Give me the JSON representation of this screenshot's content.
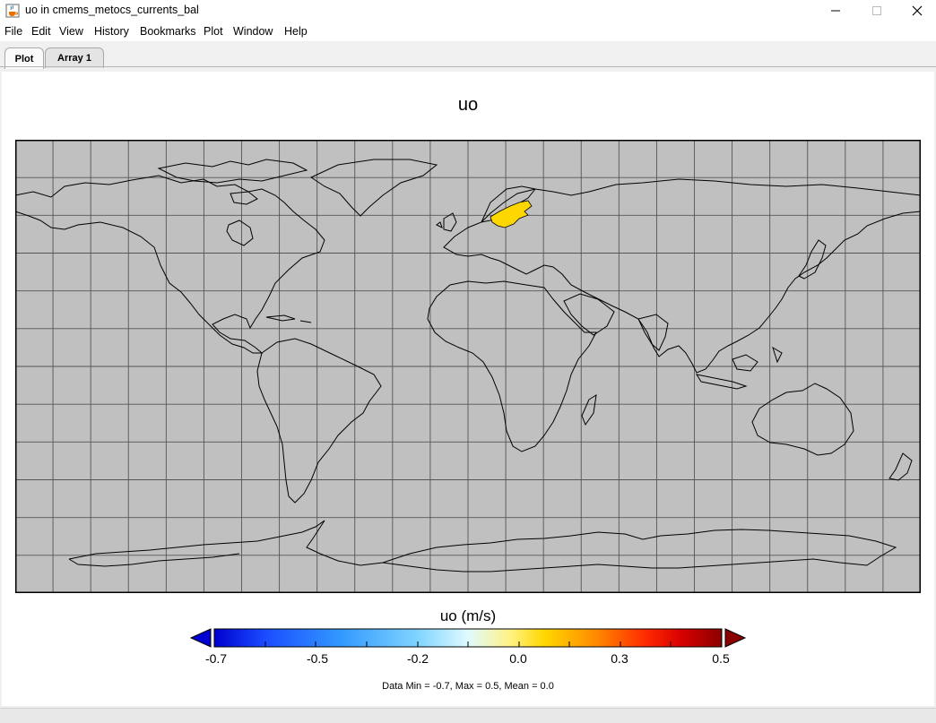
{
  "window": {
    "title": "uo in cmems_metocs_currents_bal",
    "icon": "java-cup-icon",
    "controls": [
      "minimize-icon",
      "maximize-icon",
      "close-icon"
    ]
  },
  "menu": [
    "File",
    "Edit",
    "View",
    "History",
    "Bookmarks",
    "Plot",
    "Window",
    "Help"
  ],
  "tabs": [
    {
      "label": "Plot",
      "active": true
    },
    {
      "label": "Array 1",
      "active": false
    }
  ],
  "plot": {
    "title": "uo",
    "colorbar_label": "uo (m/s)",
    "ticks": [
      "-0.7",
      "-0.5",
      "-0.2",
      "0.0",
      "0.3",
      "0.5"
    ],
    "stats": "Data Min = -0.7, Max = 0.5, Mean = 0.0",
    "colors": {
      "map_background": "#c0c0c0",
      "gridlines": "#555555",
      "coastline": "#000000",
      "data_patch": "#ffd700",
      "colorbar_stops": [
        "#0000d0",
        "#1a4cff",
        "#3399ff",
        "#7fd4ff",
        "#dffaff",
        "#fff38a",
        "#ffd800",
        "#ff8c00",
        "#ff2a00",
        "#d80000",
        "#8b0000"
      ]
    }
  }
}
